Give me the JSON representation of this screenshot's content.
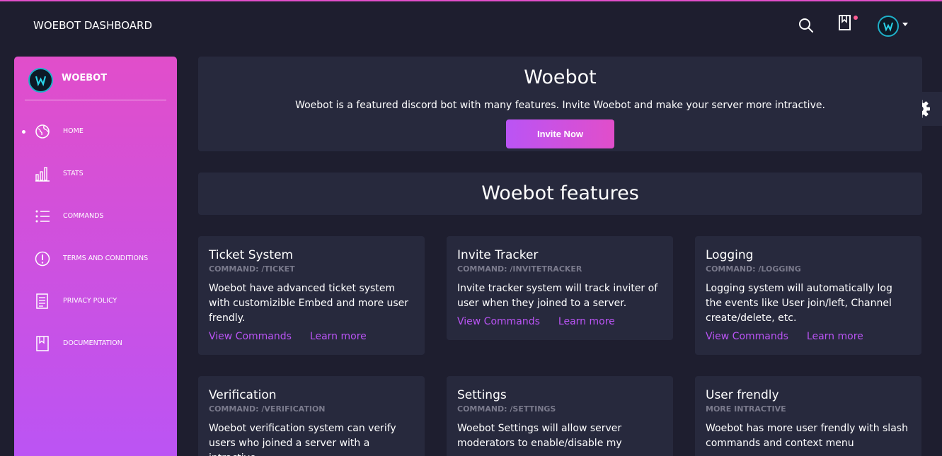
{
  "navbar": {
    "brand": "WOEBOT DASHBOARD",
    "icons": [
      "search-icon",
      "bookmark-icon",
      "avatar",
      "caret-down-icon"
    ],
    "notification_color": "#fd5d93"
  },
  "sidebar": {
    "brand": "WOEBOT",
    "gradient": [
      "#e14eca",
      "#ba54f5"
    ],
    "items": [
      {
        "label": "HOME",
        "icon": "globe-icon",
        "active": true
      },
      {
        "label": "STATS",
        "icon": "bar-chart-icon",
        "active": false
      },
      {
        "label": "COMMANDS",
        "icon": "list-icon",
        "active": false
      },
      {
        "label": "TERMS AND CONDITIONS",
        "icon": "alert-circle-icon",
        "active": false
      },
      {
        "label": "PRIVACY POLICY",
        "icon": "document-icon",
        "active": false
      },
      {
        "label": "DOCUMENTATION",
        "icon": "book-icon",
        "active": false
      }
    ]
  },
  "hero": {
    "title": "Woebot",
    "text": "Woebot is a featured discord bot with many features. Invite Woebot and make your server more intractive.",
    "button": "Invite Now"
  },
  "features": {
    "title": "Woebot features",
    "cards": [
      {
        "title": "Ticket System",
        "subtitle": "COMMAND: /TICKET",
        "desc": "Woebot have advanced ticket system with customizible Embed and more user frendly.",
        "link1": "View Commands",
        "link2": "Learn more"
      },
      {
        "title": "Invite Tracker",
        "subtitle": "COMMAND: /INVITETRACKER",
        "desc": "Invite tracker system will track inviter of user when they joined to a server.",
        "link1": "View Commands",
        "link2": "Learn more"
      },
      {
        "title": "Logging",
        "subtitle": "COMMAND: /LOGGING",
        "desc": "Logging system will automatically log the events like User join/left, Channel create/delete, etc.",
        "link1": "View Commands",
        "link2": "Learn more"
      },
      {
        "title": "Verification",
        "subtitle": "COMMAND: /VERIFICATION",
        "desc": "Woebot verification system can verify users who joined a server with a intractive"
      },
      {
        "title": "Settings",
        "subtitle": "COMMAND: /SETTINGS",
        "desc": "Woebot Settings will allow server moderators to enable/disable my"
      },
      {
        "title": "User frendly",
        "subtitle": "MORE INTRACTIVE",
        "desc": "Woebot has more user frendly with slash commands and context menu"
      }
    ]
  },
  "settings_icon": "gear-icon",
  "colors": {
    "background": "#1e1e2f",
    "card": "#27293d",
    "accent": "#ba54f5",
    "accent2": "#e14eca",
    "muted": "#7a7a8c"
  }
}
